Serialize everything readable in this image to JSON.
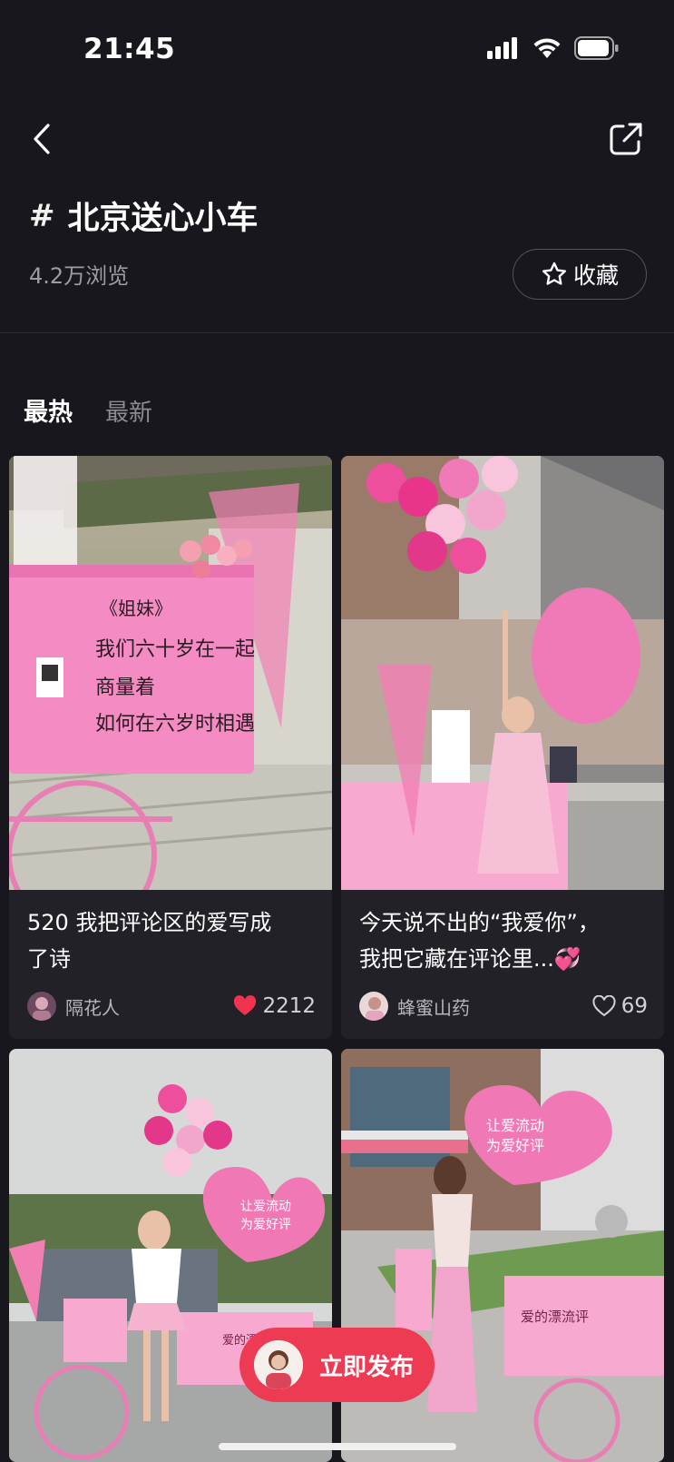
{
  "status_bar": {
    "time": "21:45",
    "icons": [
      "cellular-signal-icon",
      "wifi-icon",
      "battery-icon"
    ]
  },
  "header": {
    "back_icon": "chevron-left-icon",
    "share_icon": "share-icon",
    "topic_hash": "#",
    "topic_title": "北京送心小车",
    "views": "4.2万浏览",
    "favorite_label": "收藏",
    "favorite_icon": "star-outline-icon"
  },
  "tabs": [
    {
      "label": "最热",
      "active": true
    },
    {
      "label": "最新",
      "active": false
    }
  ],
  "posts": [
    {
      "title_line1": "520 我把评论区的爱写成",
      "title_line2": "了诗",
      "author": "隔花人",
      "likes": "2212",
      "liked": true,
      "image_text": [
        "《姐妹》",
        "我们六十岁在一起",
        "商量着",
        "如何在六岁时相遇"
      ]
    },
    {
      "title_line1": "今天说不出的“我爱你”，",
      "title_line2": "我把它藏在评论里...💞",
      "author": "蜂蜜山药",
      "likes": "69",
      "liked": false
    },
    {
      "author": "",
      "image_text": [
        "让爱流动",
        "为爱好评",
        "爱的漂流评"
      ]
    },
    {
      "author": "",
      "image_text": [
        "让爱流动",
        "为爱好评",
        "爱的漂流评"
      ]
    }
  ],
  "post_button": {
    "label": "立即发布"
  },
  "colors": {
    "background": "#18171d",
    "card": "#222128",
    "accent_red": "#ee3b54",
    "heart_red": "#f2334f",
    "pink": "#f3a6cc"
  }
}
